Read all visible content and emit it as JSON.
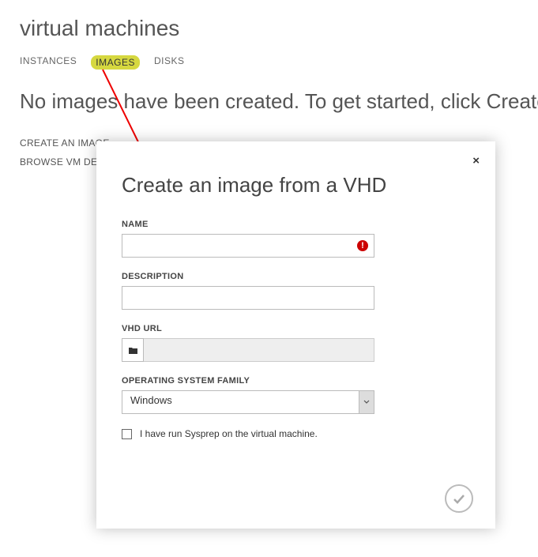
{
  "header": {
    "title": "virtual machines",
    "tabs": [
      "INSTANCES",
      "IMAGES",
      "DISKS"
    ],
    "active_tab": "IMAGES"
  },
  "empty_state": {
    "message": "No images have been created. To get started, click Create or Browse VM Depot.",
    "actions": [
      "CREATE AN IMAGE",
      "BROWSE VM DEPOT"
    ]
  },
  "modal": {
    "title": "Create an image from a VHD",
    "fields": {
      "name": {
        "label": "NAME",
        "value": "",
        "error": true
      },
      "description": {
        "label": "DESCRIPTION",
        "value": ""
      },
      "vhd_url": {
        "label": "VHD URL",
        "value": "",
        "browse_icon": "folder-icon"
      },
      "os_family": {
        "label": "OPERATING SYSTEM FAMILY",
        "value": "Windows"
      }
    },
    "checkbox": {
      "label": "I have run Sysprep on the virtual machine.",
      "checked": false
    },
    "buttons": {
      "close": "×",
      "ok": "check"
    }
  }
}
